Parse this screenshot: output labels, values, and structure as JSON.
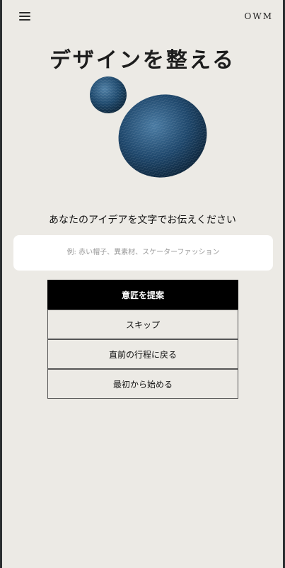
{
  "header": {
    "menu_icon": "hamburger-menu-icon",
    "brand": "OWM"
  },
  "hero": {
    "title": "デザインを整える",
    "orb_color": "#1f4a6e"
  },
  "form": {
    "prompt": "あなたのアイデアを文字でお伝えください",
    "input_value": "",
    "input_placeholder": "例: 赤い帽子、異素材、スケーターファッション"
  },
  "actions": {
    "propose": "意匠を提案",
    "skip": "スキップ",
    "back": "直前の行程に戻る",
    "restart": "最初から始める"
  }
}
